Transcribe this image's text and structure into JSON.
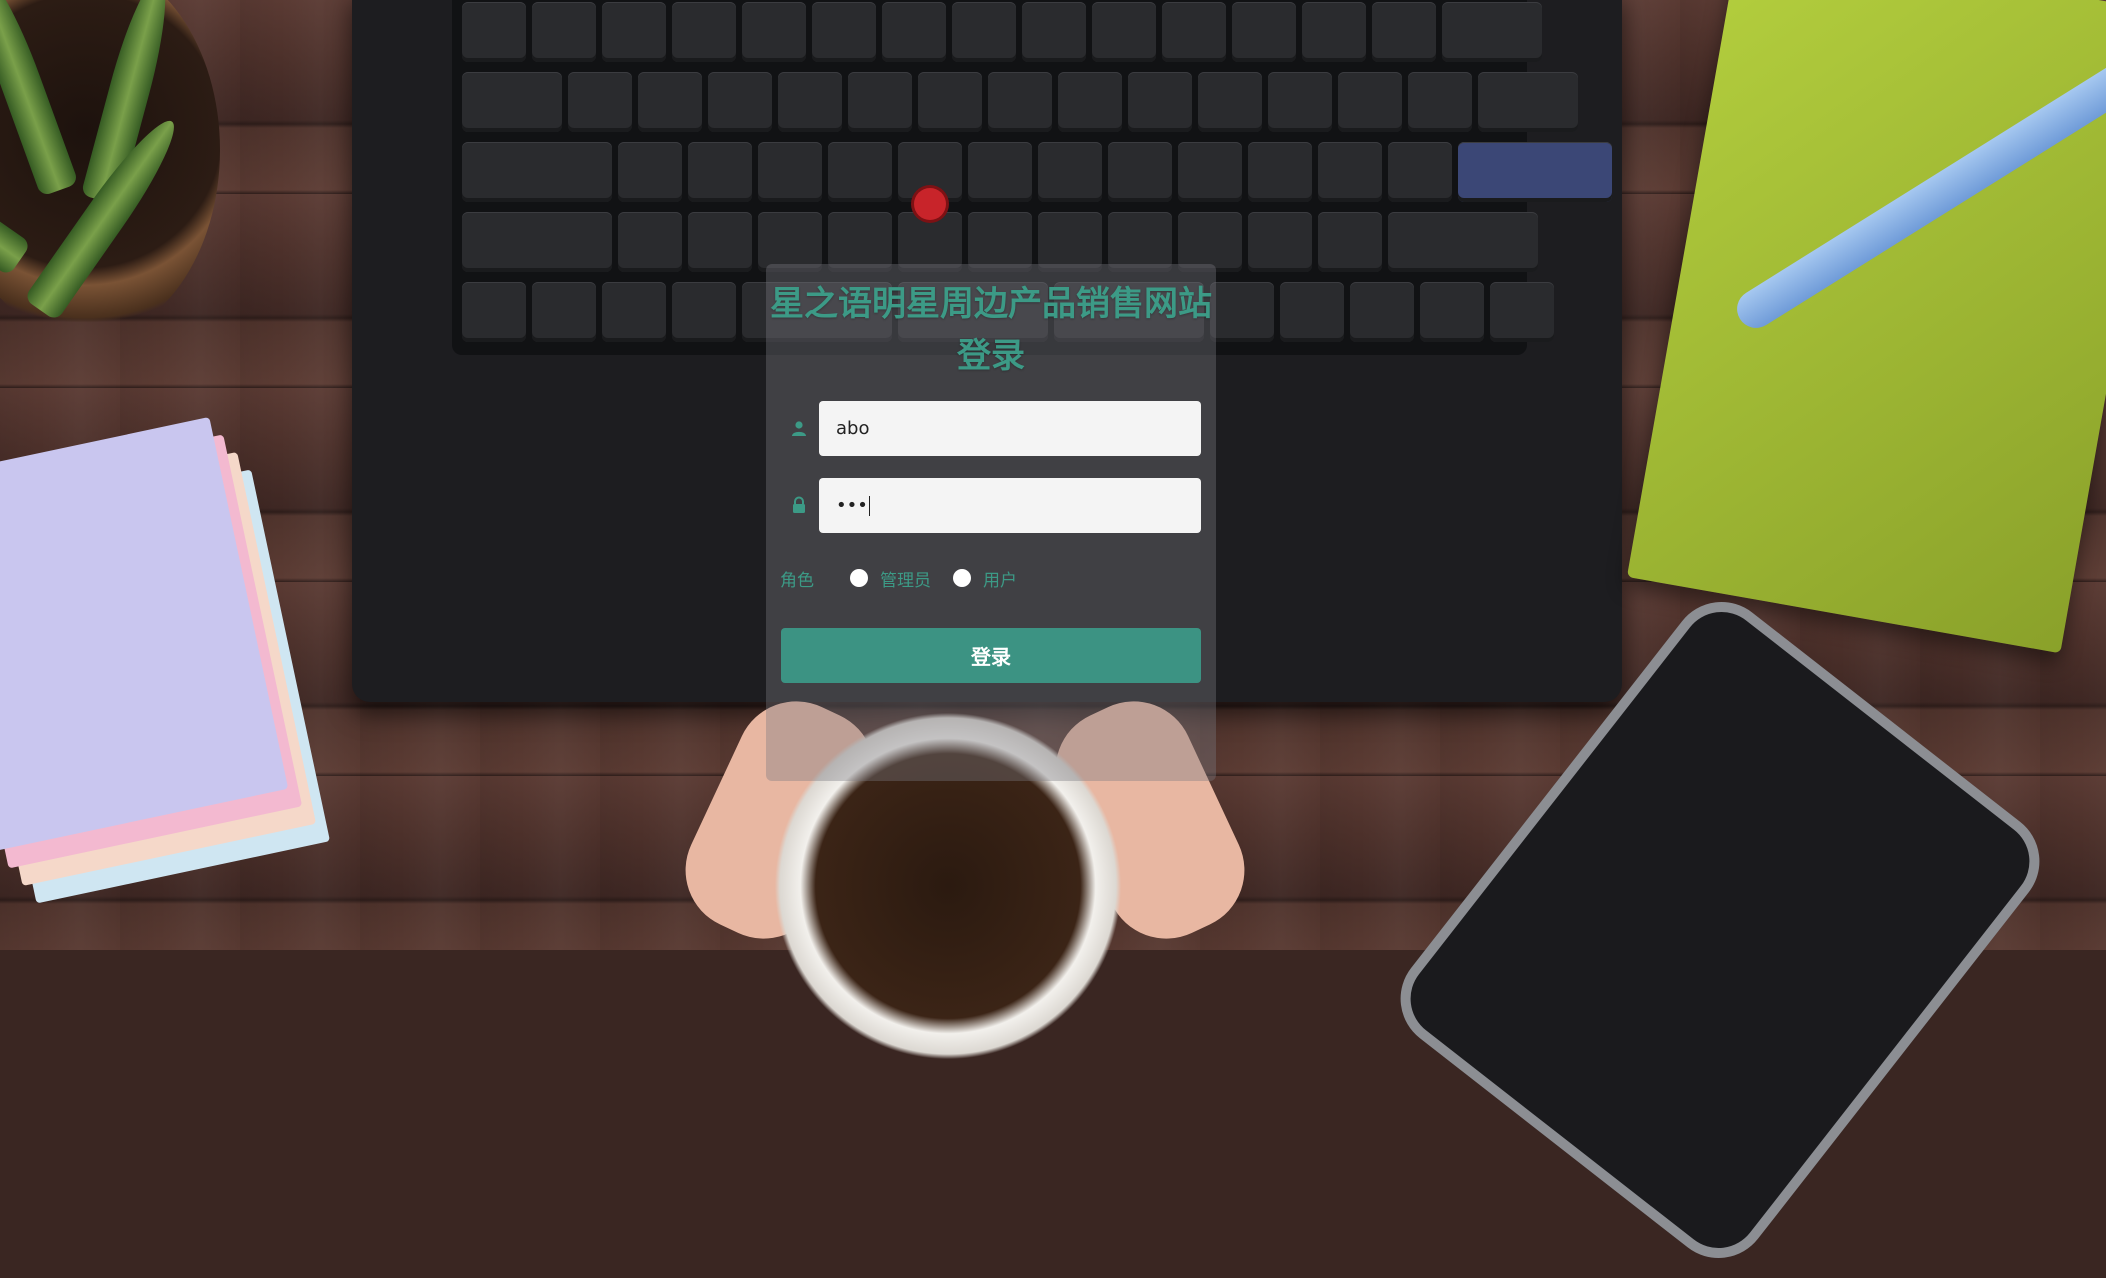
{
  "page": {
    "title": "星之语明星周边产品销售网站登录",
    "accent_color": "#3c9a86"
  },
  "login": {
    "username_icon": "user-icon",
    "username_value": "abo",
    "password_icon": "lock-icon",
    "password_value": "•••",
    "role_label": "角色",
    "role_options": [
      "管理员",
      "用户"
    ],
    "submit_label": "登录"
  }
}
